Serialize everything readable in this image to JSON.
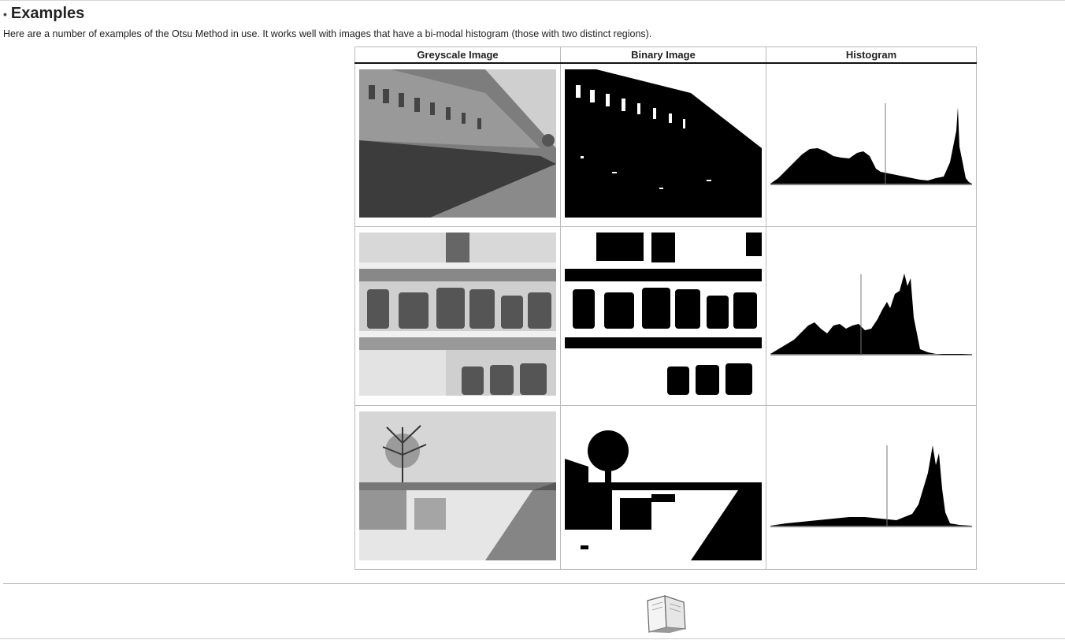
{
  "section": {
    "bullet": "•",
    "title": "Examples",
    "intro": "Here are a number of examples of the Otsu Method in use. It works well with images that have a bi-modal histogram (those with two distinct regions)."
  },
  "table": {
    "headers": [
      "Greyscale Image",
      "Binary Image",
      "Histogram"
    ],
    "rows": [
      {
        "greyscale": "greyscale-house-image",
        "binary": "binary-house-image",
        "histogram": "histogram-house"
      },
      {
        "greyscale": "greyscale-jars-image",
        "binary": "binary-jars-image",
        "histogram": "histogram-jars"
      },
      {
        "greyscale": "greyscale-snow-image",
        "binary": "binary-snow-image",
        "histogram": "histogram-snow"
      }
    ]
  },
  "footer": {
    "icon": "book-icon"
  }
}
